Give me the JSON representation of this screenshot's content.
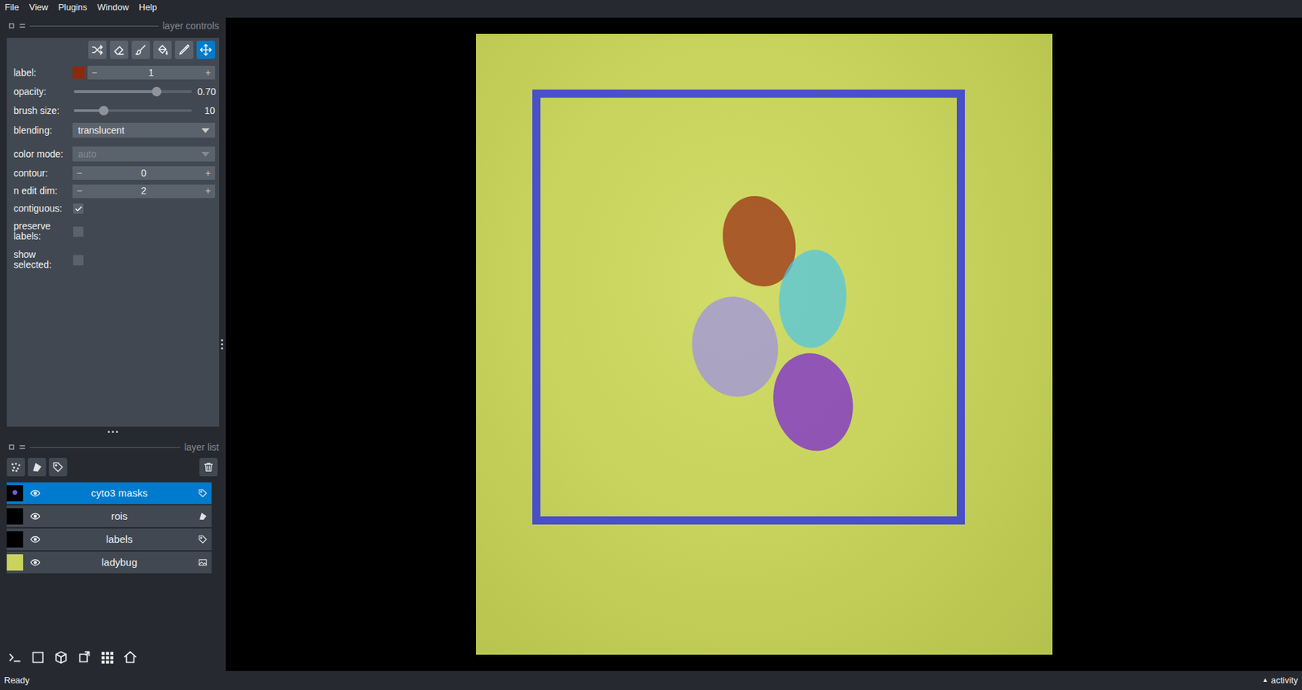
{
  "menu": [
    "File",
    "View",
    "Plugins",
    "Window",
    "Help"
  ],
  "layer_controls": {
    "title": "layer controls",
    "tools": [
      {
        "kind": "shuffle",
        "selected": false
      },
      {
        "kind": "eraser",
        "selected": false
      },
      {
        "kind": "brush",
        "selected": false
      },
      {
        "kind": "fill",
        "selected": false
      },
      {
        "kind": "picker",
        "selected": false
      },
      {
        "kind": "move",
        "selected": true
      }
    ],
    "label": {
      "caption": "label:",
      "value": "1",
      "color": "#8a2a0e",
      "minus": "−",
      "plus": "+"
    },
    "opacity": {
      "caption": "opacity:",
      "level": 0.7,
      "reading": "0.70"
    },
    "brush_size": {
      "caption": "brush size:",
      "level": 0.25,
      "reading": "10"
    },
    "blending": {
      "caption": "blending:",
      "value": "translucent",
      "disabled": false
    },
    "color_mode": {
      "caption": "color mode:",
      "value": "auto",
      "disabled": true
    },
    "contour": {
      "caption": "contour:",
      "value": "0",
      "minus": "−",
      "plus": "+"
    },
    "n_edit_dim": {
      "caption": "n edit dim:",
      "value": "2",
      "minus": "−",
      "plus": "+"
    },
    "checkboxes": [
      {
        "caption": "contiguous:",
        "checked": true
      },
      {
        "caption": "preserve labels:",
        "checked": false
      },
      {
        "caption": "show selected:",
        "checked": false
      }
    ]
  },
  "layer_list": {
    "title": "layer list",
    "buttons": [
      {
        "kind": "points"
      },
      {
        "kind": "shapes"
      },
      {
        "kind": "labels"
      },
      {
        "kind": "delete"
      }
    ],
    "layers": [
      {
        "name": "cyto3 masks",
        "kind": "labels",
        "visible": true,
        "selected": true
      },
      {
        "name": "rois",
        "kind": "shapes",
        "visible": true,
        "selected": false
      },
      {
        "name": "labels",
        "kind": "labels",
        "visible": true,
        "selected": false
      },
      {
        "name": "ladybug",
        "kind": "image",
        "visible": true,
        "selected": false
      }
    ]
  },
  "viewer_buttons": [
    {
      "kind": "console"
    },
    {
      "kind": "ndisplay"
    },
    {
      "kind": "cube"
    },
    {
      "kind": "roll"
    },
    {
      "kind": "grid"
    },
    {
      "kind": "home"
    }
  ],
  "canvas": {
    "rois": [
      {
        "color": "#2a2fe6"
      }
    ],
    "masks": [
      {
        "color": "#9a2a12"
      },
      {
        "color": "#4ec5e6"
      },
      {
        "color": "#9d8fe6"
      },
      {
        "color": "#7a22d6"
      }
    ]
  },
  "status_bar": {
    "text": "Ready",
    "activity_icon": "▲",
    "activity": "activity"
  }
}
